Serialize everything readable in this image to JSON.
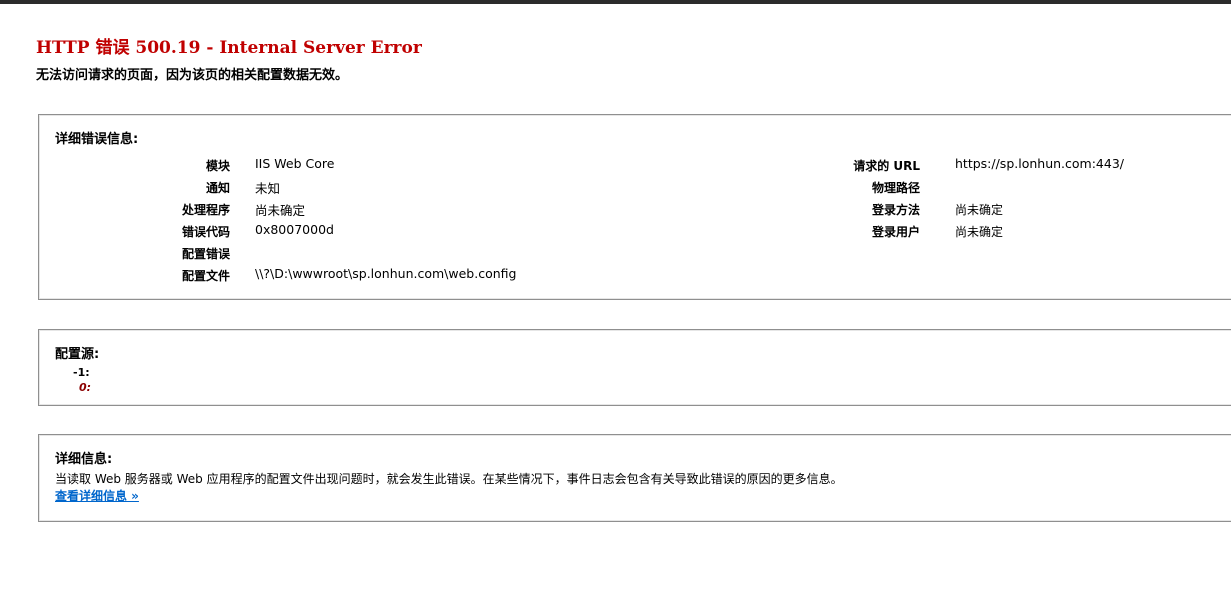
{
  "header": {
    "title": "HTTP 错误 500.19 - Internal Server Error",
    "subtitle": "无法访问请求的页面，因为该页的相关配置数据无效。"
  },
  "detail_section": {
    "heading": "详细错误信息:",
    "left": [
      {
        "label": "模块",
        "value": "IIS Web Core"
      },
      {
        "label": "通知",
        "value": "未知"
      },
      {
        "label": "处理程序",
        "value": "尚未确定"
      },
      {
        "label": "错误代码",
        "value": "0x8007000d"
      },
      {
        "label": "配置错误",
        "value": ""
      },
      {
        "label": "配置文件",
        "value": "\\\\?\\D:\\wwwroot\\sp.lonhun.com\\web.config"
      }
    ],
    "right": [
      {
        "label": "请求的 URL",
        "value": "https://sp.lonhun.com:443/"
      },
      {
        "label": "物理路径",
        "value": ""
      },
      {
        "label": "登录方法",
        "value": "尚未确定"
      },
      {
        "label": "登录用户",
        "value": "尚未确定"
      }
    ]
  },
  "config_source": {
    "heading": "配置源:",
    "line1": "-1:",
    "line2": "0:"
  },
  "more_info": {
    "heading": "详细信息:",
    "description": "当读取 Web 服务器或 Web 应用程序的配置文件出现问题时，就会发生此错误。在某些情况下，事件日志会包含有关导致此错误的原因的更多信息。",
    "link": "查看详细信息 »"
  },
  "colors": {
    "title": "#c00000",
    "link": "#0066cc",
    "border": "#8f8f8f",
    "source_error": "#8b0000"
  }
}
